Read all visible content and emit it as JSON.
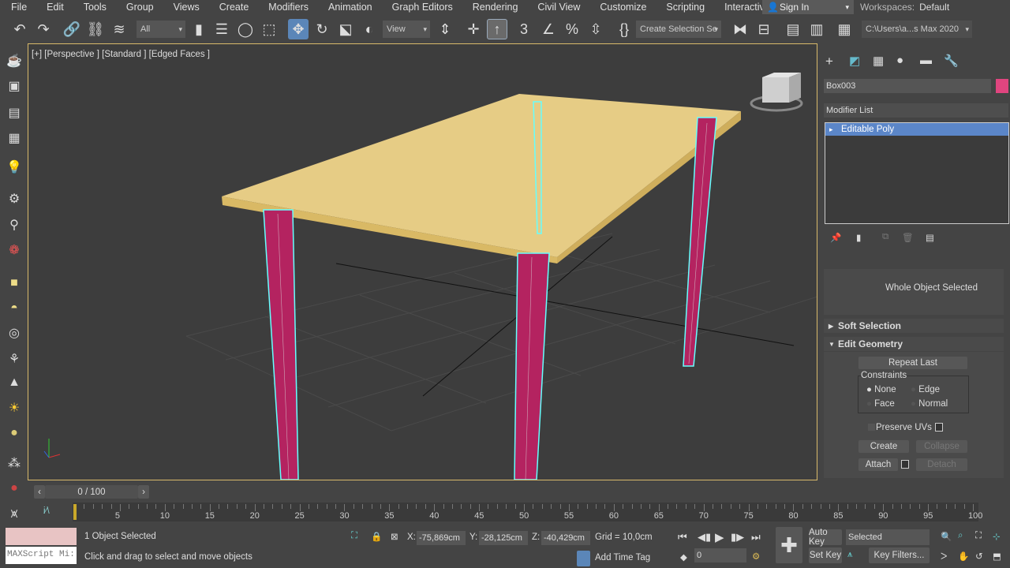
{
  "menu": [
    "File",
    "Edit",
    "Tools",
    "Group",
    "Views",
    "Create",
    "Modifiers",
    "Animation",
    "Graph Editors",
    "Rendering",
    "Civil View",
    "Customize",
    "Scripting",
    "Interactive"
  ],
  "signin": "Sign In",
  "workspaces": {
    "label": "Workspaces:",
    "value": "Default"
  },
  "toolbar": {
    "filter": "All",
    "refcoord": "View",
    "selset": "Create Selection Se",
    "project": "C:\\Users\\a...s Max 2020"
  },
  "viewport": {
    "label": "[+] [Perspective ] [Standard ] [Edged Faces ]"
  },
  "panel": {
    "object_name": "Box003",
    "object_color": "#e0457f",
    "modifier_list": "Modifier List",
    "stack_item": "Editable Poly",
    "whole_object": "Whole Object Selected",
    "soft_selection": "Soft Selection",
    "edit_geometry": "Edit Geometry",
    "repeat_last": "Repeat Last",
    "constraints": "Constraints",
    "c_none": "None",
    "c_edge": "Edge",
    "c_face": "Face",
    "c_normal": "Normal",
    "preserve_uvs": "Preserve UVs",
    "create": "Create",
    "collapse": "Collapse",
    "attach": "Attach",
    "detach": "Detach"
  },
  "timeline": {
    "frame": "0 / 100",
    "current": 0,
    "max": 100,
    "ticks": [
      "5",
      "10",
      "15",
      "20",
      "25",
      "30",
      "35",
      "40",
      "45",
      "50",
      "55",
      "60",
      "65",
      "70",
      "75",
      "80",
      "85",
      "90",
      "95",
      "100"
    ]
  },
  "status": {
    "selected": "1 Object Selected",
    "prompt": "Click and drag to select and move objects",
    "maxscript": "MAXScript Mi:",
    "x_label": "X:",
    "x": "-75,869cm",
    "y_label": "Y:",
    "y": "-28,125cm",
    "z_label": "Z:",
    "z": "-40,429cm",
    "grid": "Grid = 10,0cm",
    "add_time_tag": "Add Time Tag",
    "frame_field": "0",
    "auto_key": "Auto Key",
    "set_key": "Set Key",
    "key_mode": "Selected",
    "key_filters": "Key Filters..."
  }
}
